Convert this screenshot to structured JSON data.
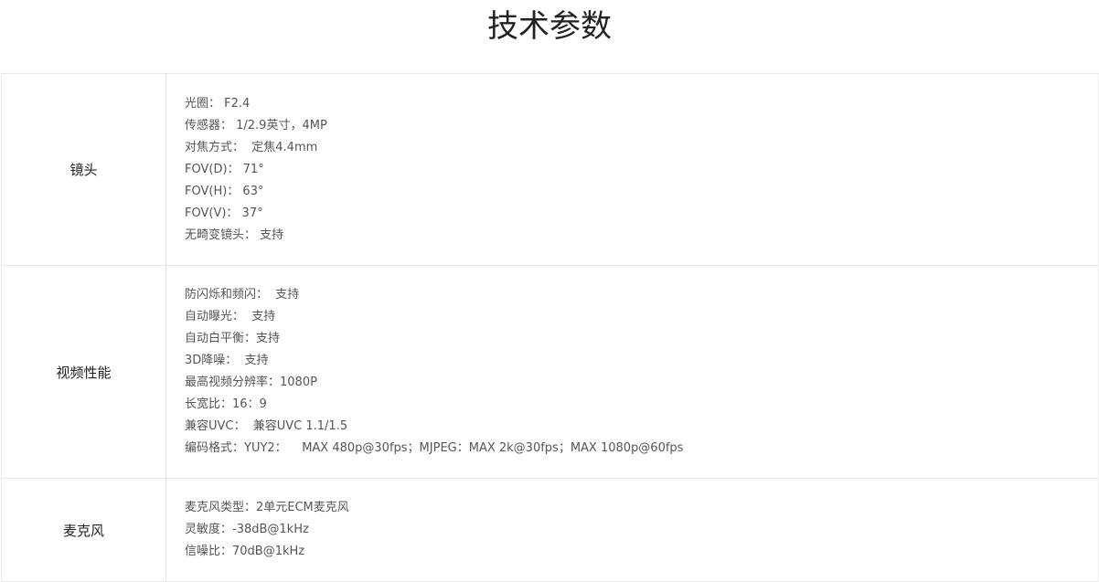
{
  "page": {
    "title": "技术参数"
  },
  "sections": [
    {
      "label": "镜头",
      "items": [
        "光圈： F2.4",
        "传感器： 1/2.9英寸，4MP",
        "对焦方式：  定焦4.4mm",
        "FOV(D)： 71°",
        "FOV(H)： 63°",
        "FOV(V)： 37°",
        "无畸变镜头： 支持"
      ]
    },
    {
      "label": "视频性能",
      "items": [
        "防闪烁和频闪：  支持",
        "自动曝光：  支持",
        "自动白平衡：支持",
        "3D降噪：  支持",
        "最高视频分辨率：1080P",
        "长宽比：16：9",
        "兼容UVC：  兼容UVC 1.1/1.5",
        "编码格式：YUY2：    MAX 480p@30fps；MJPEG：MAX 2k@30fps；MAX 1080p@60fps"
      ]
    },
    {
      "label": "麦克风",
      "items": [
        "麦克风类型：2单元ECM麦克风",
        "灵敏度：-38dB@1kHz",
        "信噪比：70dB@1kHz"
      ]
    }
  ]
}
